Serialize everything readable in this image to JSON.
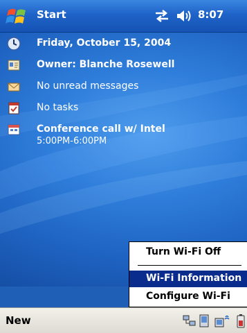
{
  "titlebar": {
    "start_label": "Start",
    "time": "8:07",
    "icons": [
      "windows-flag-icon",
      "connectivity-icon",
      "volume-icon"
    ]
  },
  "today": {
    "items": [
      {
        "icon": "clock-icon",
        "text": "Friday, October 15, 2004",
        "bold": true
      },
      {
        "icon": "owner-card-icon",
        "text": "Owner: Blanche Rosewell",
        "bold": true
      },
      {
        "icon": "inbox-icon",
        "text": "No unread messages",
        "bold": false
      },
      {
        "icon": "tasks-icon",
        "text": "No tasks",
        "bold": false
      },
      {
        "icon": "calendar-icon",
        "text": "Conference call w/ Intel",
        "subtext": "5:00PM-6:00PM",
        "bold": true
      }
    ]
  },
  "context_menu": {
    "items": [
      {
        "label": "Turn Wi-Fi Off",
        "highlighted": false
      },
      {
        "label": "Wi-Fi Information",
        "highlighted": true
      },
      {
        "label": "Configure Wi-Fi",
        "highlighted": false
      }
    ]
  },
  "bottombar": {
    "new_label": "New",
    "tray_icons": [
      "network-tray-icon",
      "pc-sync-tray-icon",
      "wifi-tray-icon",
      "battery-tray-icon"
    ]
  },
  "colors": {
    "title_bar": "#1f63c8",
    "menu_highlight": "#0a2c8c",
    "bottom_bar": "#e6e4dc"
  }
}
